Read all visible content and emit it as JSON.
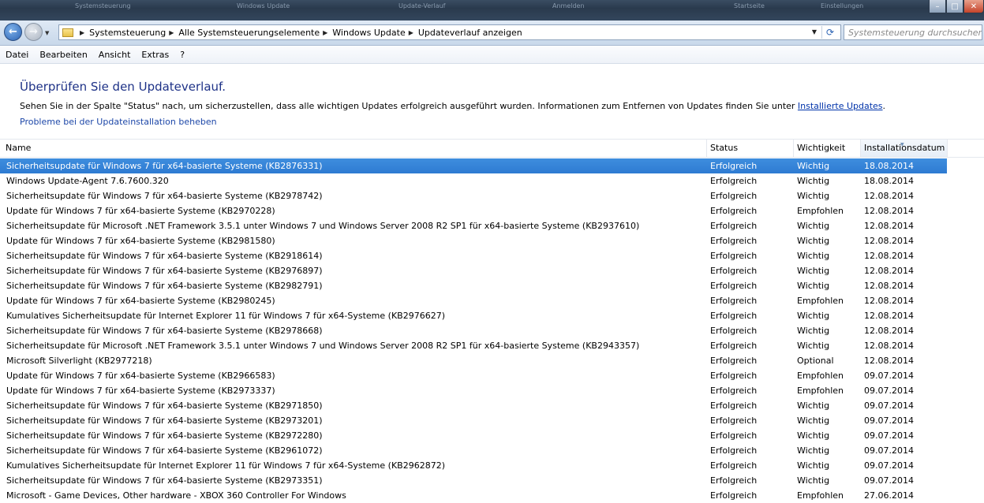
{
  "titlebar": {
    "blurred": [
      "Systemsteuerung",
      "Windows Update",
      "Update-Verlauf",
      "Anmelden",
      "Startseite",
      "Einstellungen"
    ],
    "minimize": "–",
    "maximize": "□",
    "close": "✕"
  },
  "nav": {
    "back_glyph": "←",
    "forward_glyph": "→",
    "recent_glyph": "▼",
    "breadcrumb": [
      "Systemsteuerung",
      "Alle Systemsteuerungselemente",
      "Windows Update",
      "Updateverlauf anzeigen"
    ],
    "breadcrumb_sep": "▶",
    "dropdown_glyph": "▼",
    "refresh_glyph": "⟳",
    "search_placeholder": "Systemsteuerung durchsuchen"
  },
  "menu": [
    "Datei",
    "Bearbeiten",
    "Ansicht",
    "Extras",
    "?"
  ],
  "page": {
    "title": "Überprüfen Sie den Updateverlauf.",
    "description": "Sehen Sie in der Spalte \"Status\" nach, um sicherzustellen, dass alle wichtigen Updates erfolgreich ausgeführt wurden. Informationen zum Entfernen von Updates finden Sie unter ",
    "installed_link": "Installierte Updates",
    "description_end": ".",
    "problems_link": "Probleme bei der Updateinstallation beheben"
  },
  "columns": [
    "Name",
    "Status",
    "Wichtigkeit",
    "Installationsdatum"
  ],
  "rows": [
    [
      "Sicherheitsupdate für Windows 7 für x64-basierte Systeme (KB2876331)",
      "Erfolgreich",
      "Wichtig",
      "18.08.2014"
    ],
    [
      "Windows Update-Agent 7.6.7600.320",
      "Erfolgreich",
      "Wichtig",
      "18.08.2014"
    ],
    [
      "Sicherheitsupdate für Windows 7 für x64-basierte Systeme (KB2978742)",
      "Erfolgreich",
      "Wichtig",
      "12.08.2014"
    ],
    [
      "Update für Windows 7 für x64-basierte Systeme (KB2970228)",
      "Erfolgreich",
      "Empfohlen",
      "12.08.2014"
    ],
    [
      "Sicherheitsupdate für Microsoft .NET Framework 3.5.1 unter Windows 7 und Windows Server 2008 R2 SP1 für x64-basierte Systeme (KB2937610)",
      "Erfolgreich",
      "Wichtig",
      "12.08.2014"
    ],
    [
      "Update für Windows 7 für x64-basierte Systeme (KB2981580)",
      "Erfolgreich",
      "Wichtig",
      "12.08.2014"
    ],
    [
      "Sicherheitsupdate für Windows 7 für x64-basierte Systeme (KB2918614)",
      "Erfolgreich",
      "Wichtig",
      "12.08.2014"
    ],
    [
      "Sicherheitsupdate für Windows 7 für x64-basierte Systeme (KB2976897)",
      "Erfolgreich",
      "Wichtig",
      "12.08.2014"
    ],
    [
      "Sicherheitsupdate für Windows 7 für x64-basierte Systeme (KB2982791)",
      "Erfolgreich",
      "Wichtig",
      "12.08.2014"
    ],
    [
      "Update für Windows 7 für x64-basierte Systeme (KB2980245)",
      "Erfolgreich",
      "Empfohlen",
      "12.08.2014"
    ],
    [
      "Kumulatives Sicherheitsupdate für Internet Explorer 11 für Windows 7 für x64-Systeme (KB2976627)",
      "Erfolgreich",
      "Wichtig",
      "12.08.2014"
    ],
    [
      "Sicherheitsupdate für Windows 7 für x64-basierte Systeme (KB2978668)",
      "Erfolgreich",
      "Wichtig",
      "12.08.2014"
    ],
    [
      "Sicherheitsupdate für Microsoft .NET Framework 3.5.1 unter Windows 7 und Windows Server 2008 R2 SP1 für x64-basierte Systeme (KB2943357)",
      "Erfolgreich",
      "Wichtig",
      "12.08.2014"
    ],
    [
      "Microsoft Silverlight (KB2977218)",
      "Erfolgreich",
      "Optional",
      "12.08.2014"
    ],
    [
      "Update für Windows 7 für x64-basierte Systeme (KB2966583)",
      "Erfolgreich",
      "Empfohlen",
      "09.07.2014"
    ],
    [
      "Update für Windows 7 für x64-basierte Systeme (KB2973337)",
      "Erfolgreich",
      "Empfohlen",
      "09.07.2014"
    ],
    [
      "Sicherheitsupdate für Windows 7 für x64-basierte Systeme (KB2971850)",
      "Erfolgreich",
      "Wichtig",
      "09.07.2014"
    ],
    [
      "Sicherheitsupdate für Windows 7 für x64-basierte Systeme (KB2973201)",
      "Erfolgreich",
      "Wichtig",
      "09.07.2014"
    ],
    [
      "Sicherheitsupdate für Windows 7 für x64-basierte Systeme (KB2972280)",
      "Erfolgreich",
      "Wichtig",
      "09.07.2014"
    ],
    [
      "Sicherheitsupdate für Windows 7 für x64-basierte Systeme (KB2961072)",
      "Erfolgreich",
      "Wichtig",
      "09.07.2014"
    ],
    [
      "Kumulatives Sicherheitsupdate für Internet Explorer 11 für Windows 7 für x64-Systeme (KB2962872)",
      "Erfolgreich",
      "Wichtig",
      "09.07.2014"
    ],
    [
      "Sicherheitsupdate für Windows 7 für x64-basierte Systeme (KB2973351)",
      "Erfolgreich",
      "Wichtig",
      "09.07.2014"
    ],
    [
      "Microsoft - Game Devices, Other hardware - XBOX 360 Controller For Windows",
      "Erfolgreich",
      "Empfohlen",
      "27.06.2014"
    ]
  ],
  "selected_row": 0,
  "colors": {
    "title": "#1e3287",
    "link": "#1d47a8",
    "selection": "#3384d9"
  },
  "icons": {
    "folder": "folder-icon",
    "back": "back-arrow-icon",
    "forward": "forward-arrow-icon",
    "refresh": "refresh-icon"
  }
}
